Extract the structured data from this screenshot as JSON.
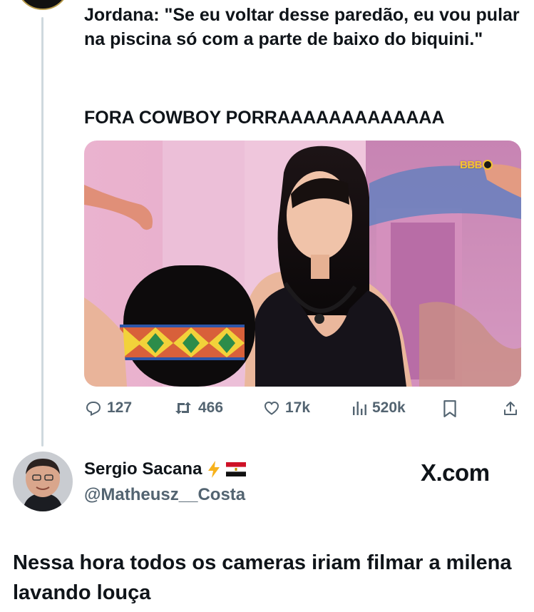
{
  "quoted_tweet": {
    "text": "Jordana: \"Se eu voltar desse paredão, eu vou pular na piscina só com a parte de baixo do biquini.\"",
    "text2": "FORA COWBOY PORRAAAAAAAAAAAAA",
    "media": {
      "watermark": "BBB"
    },
    "stats": {
      "replies": "127",
      "reposts": "466",
      "likes": "17k",
      "views": "520k"
    }
  },
  "reply": {
    "author_name": "Sergio Sacana",
    "author_emojis": [
      "lightning-icon",
      "flag-icon"
    ],
    "author_handle": "@Matheusz__Costa",
    "site_label": "X.com",
    "text": "Nessa hora todos os cameras iriam filmar a milena lavando louça"
  },
  "colors": {
    "text": "#0f1419",
    "muted": "#536471",
    "thread_line": "#cfd9de",
    "watermark": "#f4c430"
  }
}
